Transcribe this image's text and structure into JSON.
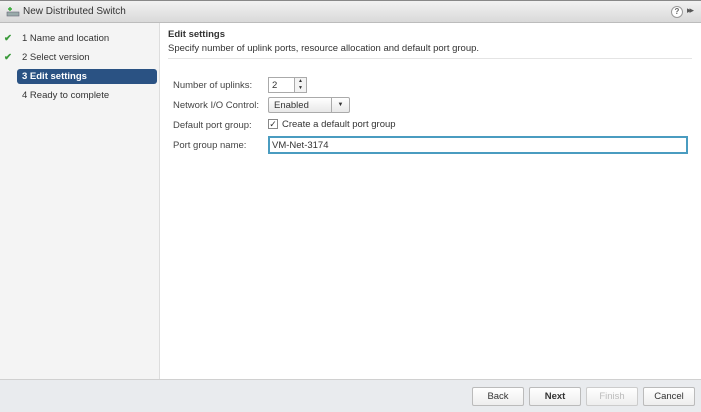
{
  "window": {
    "title": "New Distributed Switch",
    "help": "?",
    "more": "▸▸"
  },
  "steps": [
    {
      "label": "1  Name and location",
      "done": true
    },
    {
      "label": "2  Select version",
      "done": true
    },
    {
      "label": "3  Edit settings",
      "active": true
    },
    {
      "label": "4  Ready to complete"
    }
  ],
  "main": {
    "title": "Edit settings",
    "subtitle": "Specify number of uplink ports, resource allocation and default port group.",
    "uplinks_label": "Number of uplinks:",
    "uplinks_value": "2",
    "nioc_label": "Network I/O Control:",
    "nioc_value": "Enabled",
    "default_pg_label": "Default port group:",
    "default_pg_checkbox": "Create a default port group",
    "default_pg_checked": true,
    "pg_name_label": "Port group name:",
    "pg_name_value": "VM-Net-3174"
  },
  "footer": {
    "back": "Back",
    "next": "Next",
    "finish": "Finish",
    "cancel": "Cancel"
  }
}
